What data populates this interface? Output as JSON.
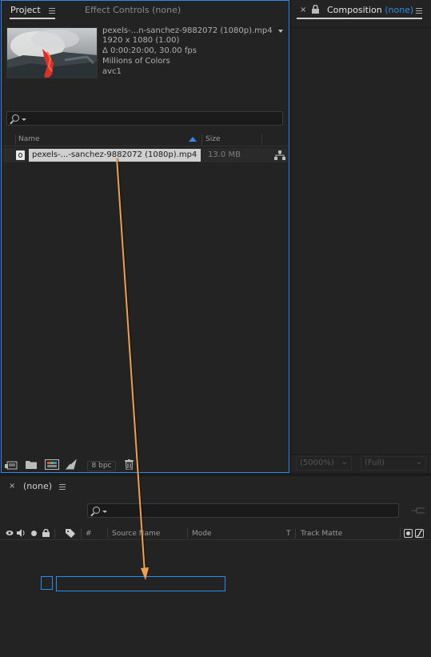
{
  "project_panel": {
    "tab_project": "Project",
    "tab_effect_controls": "Effect Controls (none)",
    "item": {
      "name": "pexels-...n-sanchez-9882072 (1080p).mp4",
      "dimensions": "1920 x 1080 (1.00)",
      "duration": "Δ 0:00:20:00, 30.00 fps",
      "colors": "Millions of Colors",
      "codec": "avc1"
    },
    "columns": {
      "name": "Name",
      "size": "Size"
    },
    "rows": [
      {
        "name": "pexels-...-sanchez-9882072 (1080p).mp4",
        "size": "13.0 MB"
      }
    ],
    "bpc": "8 bpc"
  },
  "composition_panel": {
    "title": "Composition",
    "title_value": "(none)",
    "zoom": "(5000%)",
    "resolution": "(Full)"
  },
  "timeline_panel": {
    "tab": "(none)",
    "columns": {
      "hash": "#",
      "source_name": "Source Name",
      "mode": "Mode",
      "t": "T",
      "track_matte": "Track Matte"
    }
  },
  "colors": {
    "accent": "#2d8ceb",
    "arrow": "#f0a050"
  }
}
